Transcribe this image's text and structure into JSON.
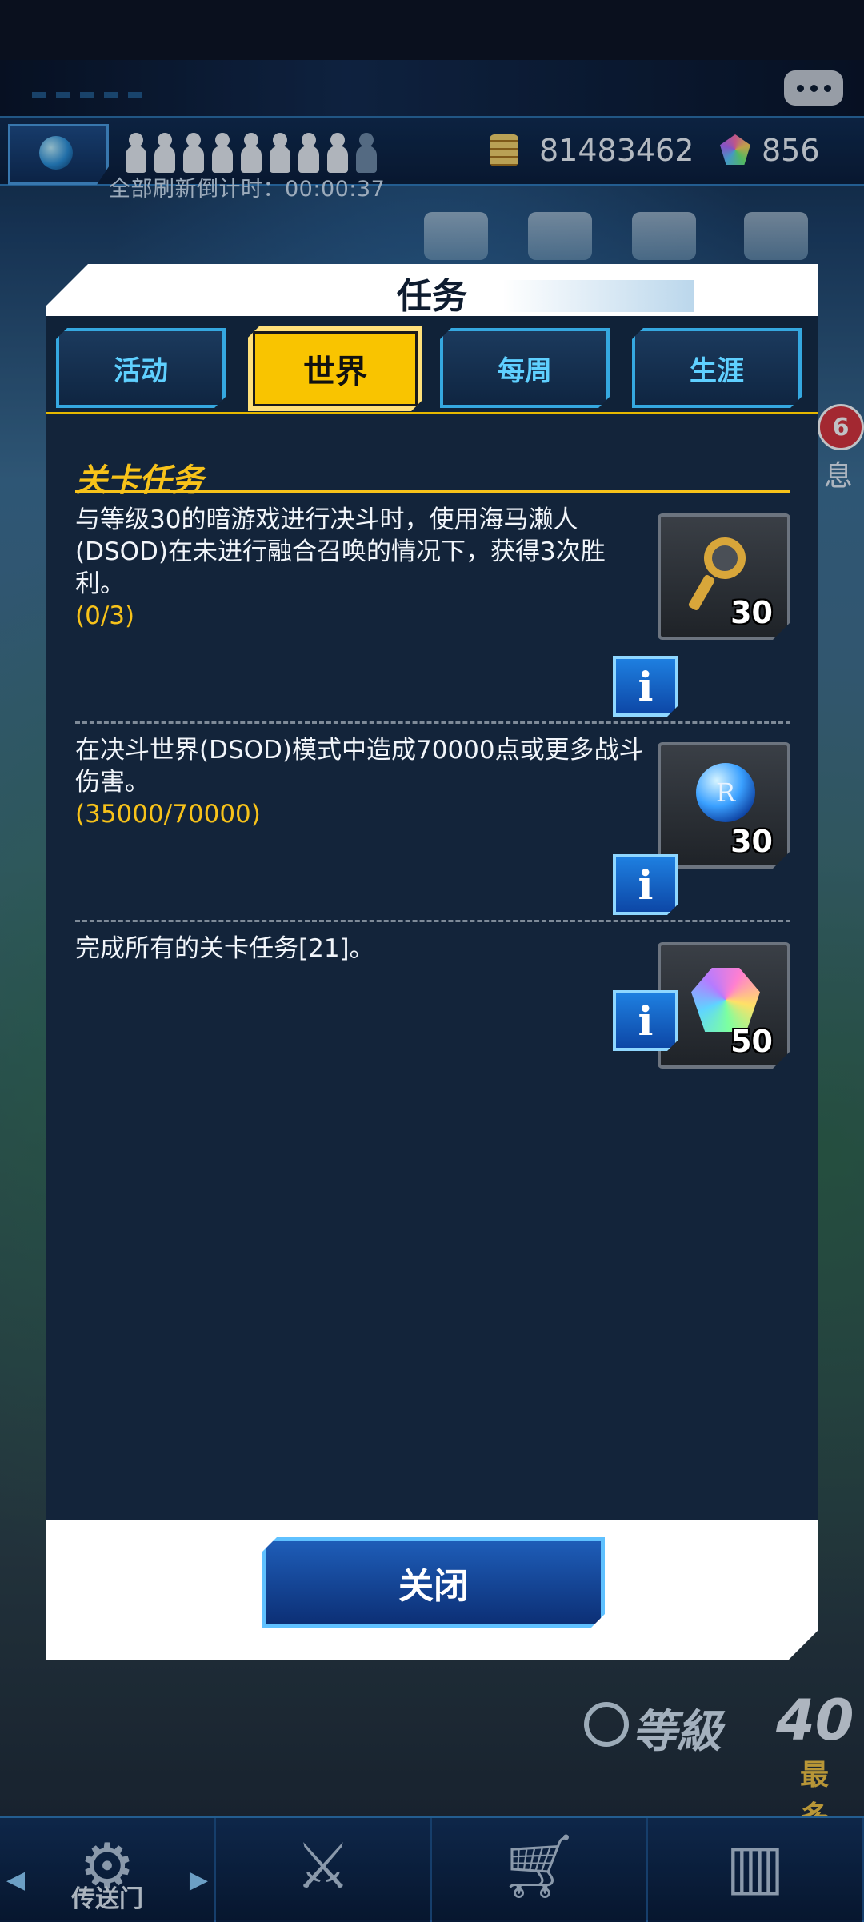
{
  "hud": {
    "refresh_timer": "全部刷新倒计时：00:00:37",
    "gold": "81483462",
    "gems": "856",
    "side_badge": "6",
    "side_label": "息"
  },
  "dialog": {
    "title": "任务",
    "tabs": [
      {
        "label": "活动",
        "active": false
      },
      {
        "label": "世界",
        "active": true
      },
      {
        "label": "每周",
        "active": false
      },
      {
        "label": "生涯",
        "active": false
      }
    ],
    "section_title": "关卡任务",
    "tasks": [
      {
        "text": "与等级30的暗游戏进行决斗时，使用海马濑人(DSOD)在未进行融合召唤的情况下，获得3次胜利。",
        "progress": "(0/3)",
        "reward_icon": "key-icon",
        "reward_count": "30"
      },
      {
        "text": "在决斗世界(DSOD)模式中造成70000点或更多战斗伤害。",
        "progress": "(35000/70000)",
        "reward_icon": "orb-icon",
        "reward_count": "30"
      },
      {
        "text": "完成所有的关卡任务[21]。",
        "progress": "",
        "reward_icon": "gem-icon",
        "reward_count": "50"
      }
    ],
    "info_label": "i",
    "orb_letter": "R",
    "close_label": "关闭"
  },
  "footer": {
    "level_label": "等級",
    "level_value": "40",
    "level_max": "最多",
    "nav": [
      {
        "name": "gate",
        "label": "传送门",
        "icon": "gate-icon"
      },
      {
        "name": "duel",
        "label": "",
        "icon": "crossed-swords-icon"
      },
      {
        "name": "shop",
        "label": "",
        "icon": "cart-icon"
      },
      {
        "name": "cards",
        "label": "",
        "icon": "cards-icon"
      }
    ]
  }
}
